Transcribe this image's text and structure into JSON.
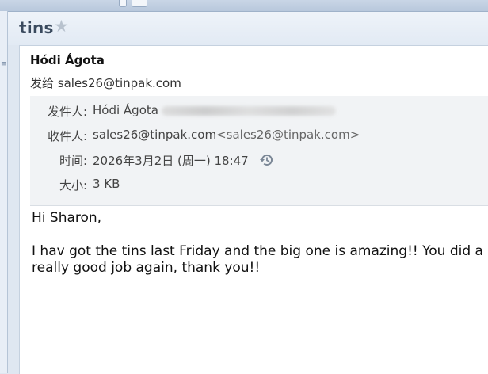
{
  "message": {
    "subject": "tins",
    "from_name": "Hódi Ágota",
    "to_line": "发给 sales26@tinpak.com",
    "details": {
      "from_label": "发件人:",
      "from_value": "Hódi Ágota",
      "to_label": "收件人:",
      "to_value": "sales26@tinpak.com",
      "to_angle": "<sales26@tinpak.com>",
      "time_label": "时间:",
      "time_value": "2026年3月2日 (周一) 18:47",
      "size_label": "大小:",
      "size_value": "3 KB"
    },
    "body": {
      "greeting": "Hi Sharon,",
      "paragraph": "I hav got the tins last Friday and the big one is amazing!! You did a really good job again, thank you!!"
    }
  },
  "icons": {
    "star": "star-icon",
    "history": "history-icon"
  },
  "colors": {
    "header_bg": "#dfe7f1",
    "details_bg": "#f1f3f5",
    "subject_text": "#3a4a5e"
  }
}
